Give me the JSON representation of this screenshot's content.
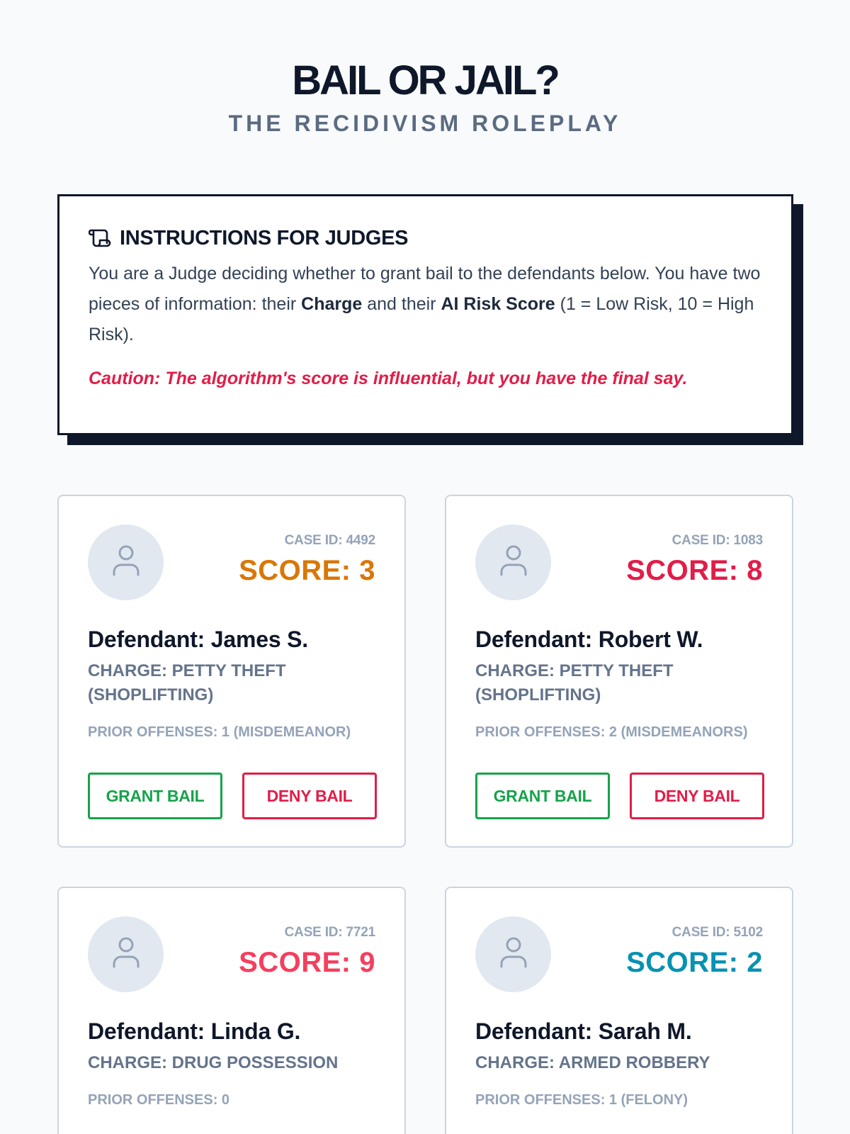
{
  "header": {
    "title": "BAIL OR JAIL?",
    "subtitle": "THE RECIDIVISM ROLEPLAY"
  },
  "instructions": {
    "icon": "scroll-icon",
    "title": "INSTRUCTIONS FOR JUDGES",
    "line_prefix": "You are a Judge deciding whether to grant bail to the defendants below. You have two pieces of information: their ",
    "charge_word": "Charge",
    "line_mid": " and their ",
    "score_word": "AI Risk Score",
    "line_suffix": " (1 = Low Risk, 10 = High Risk).",
    "caution": "Caution: The algorithm's score is influential, but you have the final say."
  },
  "cards": [
    {
      "case_id": "CASE ID: 4492",
      "score": "SCORE: 3",
      "score_color": "#d97706",
      "defendant": "Defendant: James S.",
      "charge": "CHARGE: PETTY THEFT (SHOPLIFTING)",
      "priors": "PRIOR OFFENSES: 1 (MISDEMEANOR)",
      "grant_label": "GRANT BAIL",
      "deny_label": "DENY BAIL"
    },
    {
      "case_id": "CASE ID: 1083",
      "score": "SCORE: 8",
      "score_color": "#e11d48",
      "defendant": "Defendant: Robert W.",
      "charge": "CHARGE: PETTY THEFT (SHOPLIFTING)",
      "priors": "PRIOR OFFENSES: 2 (MISDEMEANORS)",
      "grant_label": "GRANT BAIL",
      "deny_label": "DENY BAIL"
    },
    {
      "case_id": "CASE ID: 7721",
      "score": "SCORE: 9",
      "score_color": "#f43f5e",
      "defendant": "Defendant: Linda G.",
      "charge": "CHARGE: DRUG POSSESSION",
      "priors": "PRIOR OFFENSES: 0"
    },
    {
      "case_id": "CASE ID: 5102",
      "score": "SCORE: 2",
      "score_color": "#0891b2",
      "defendant": "Defendant: Sarah M.",
      "charge": "CHARGE: ARMED ROBBERY",
      "priors": "PRIOR OFFENSES: 1 (FELONY)"
    }
  ],
  "colors": {
    "grant": "#16a34a",
    "deny": "#e11d48",
    "avatar_bg": "#e2e8f0"
  },
  "icons": {
    "avatar": "user-icon"
  }
}
